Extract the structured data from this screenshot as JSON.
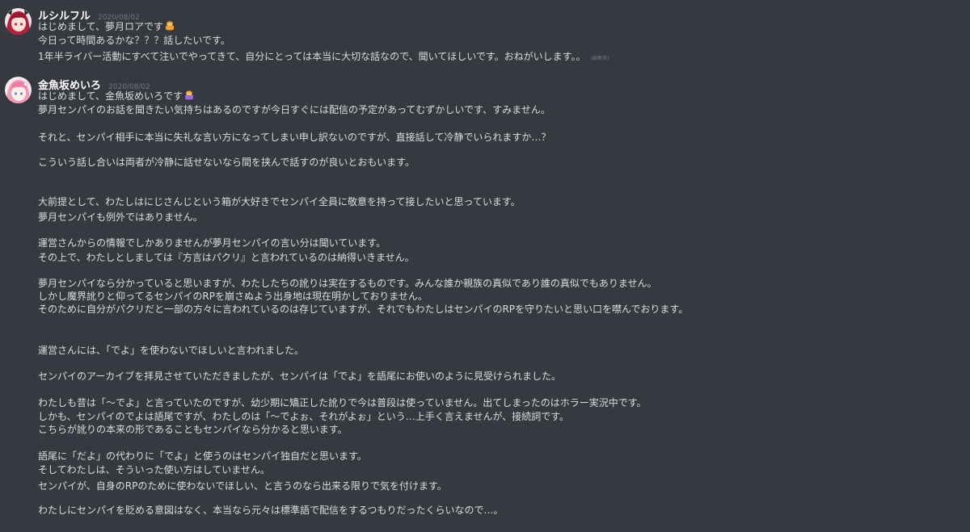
{
  "messages": [
    {
      "username": "ルシルフル",
      "timestamp": "2020/08/02",
      "avatar_icon": "anime-girl-red-hair-avatar",
      "lines": [
        "はじめまして、夢月ロアです",
        "今日って時間あるかな？？？話したいです。",
        "1年半ライバー活動にすべて注いでやってきて、自分にとっては本当に大切な話なので、聞いてほしいです。おねがいします。。"
      ],
      "emoji_icon": "person-bowing-emoji",
      "edited_label": "(編集済)"
    },
    {
      "username": "金魚坂めいろ",
      "timestamp": "2020/08/02",
      "avatar_icon": "anime-girl-pink-hair-avatar",
      "emoji_icon": "person-bowing-emoji",
      "lines": [
        "はじめまして、金魚坂めいろです",
        "夢月センパイのお話を聞きたい気持ちはあるのですが今日すぐには配信の予定があってむずかしいです、すみません。",
        "それと、センパイ相手に本当に失礼な言い方になってしまい申し訳ないのですが、直接話して冷静でいられますか…？",
        "こういう話し合いは両者が冷静に話せないなら間を挟んで話すのが良いとおもいます。",
        "大前提として、わたしはにじさんじという箱が大好きでセンパイ全員に敬意を持って接したいと思っています。",
        "夢月センパイも例外ではありません。",
        "運営さんからの情報でしかありませんが夢月センパイの言い分は聞いています。",
        "その上で、わたしとしましては『方言はパクリ』と言われているのは納得いきません。",
        "夢月センパイなら分かっていると思いますが、わたしたちの訛りは実在するものです。みんな誰か親族の真似であり誰の真似でもありません。",
        "しかし魔界訛りと仰ってるセンパイのRPを崩さぬよう出身地は現在明かしておりません。",
        "そのために自分がパクリだと一部の方々に言われているのは存じていますが、それでもわたしはセンパイのRPを守りたいと思い口を噤んでおります。",
        "運営さんには、「でよ」を使わないでほしいと言われました。",
        "センパイのアーカイブを拝見させていただきましたが、センパイは「でよ」を語尾にお使いのように見受けられました。",
        "わたしも昔は「〜でよ」と言っていたのですが、幼少期に矯正した訛りで今は普段は使っていません。出てしまったのはホラー実況中です。",
        "しかも、センパイのでよは語尾ですが、わたしのは「〜でよぉ、それがよぉ」という…上手く言えませんが、接続詞です。",
        "こちらが訛りの本来の形であることもセンパイなら分かると思います。",
        "語尾に「だよ」の代わりに「でよ」と使うのはセンパイ独自だと思います。",
        "そしてわたしは、そういった使い方はしていません。",
        "センパイが、自身のRPのために使わないでほしい、と言うのなら出来る限りで気を付けます。",
        "わたしにセンパイを貶める意図はなく、本当なら元々は標準語で配信をするつもりだったくらいなので…。"
      ]
    }
  ]
}
